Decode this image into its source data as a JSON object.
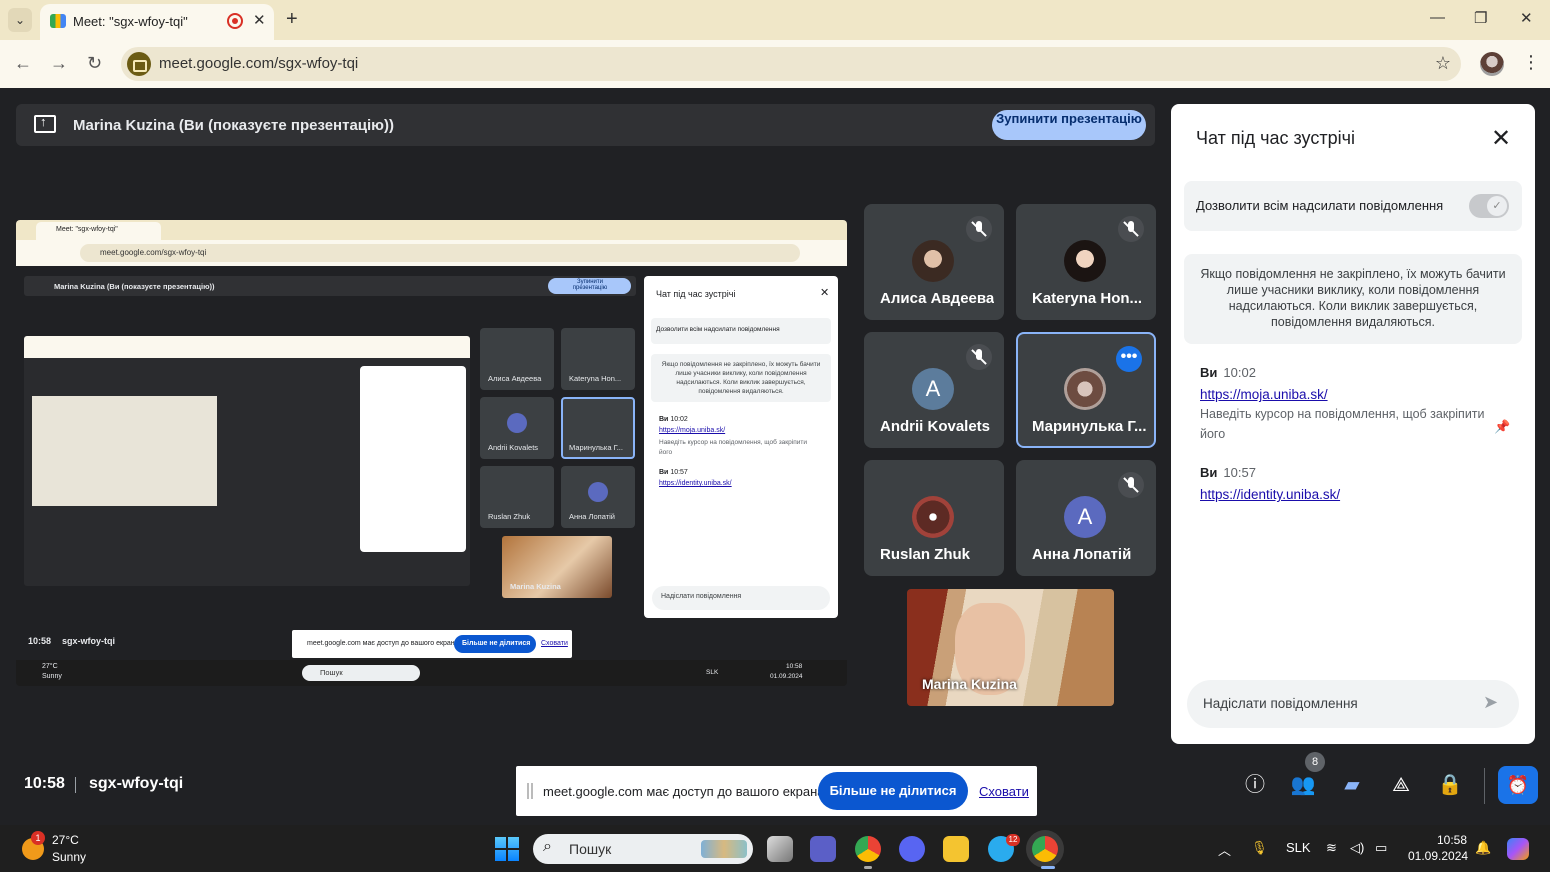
{
  "browser": {
    "tab_title": "Meet: \"sgx-wfoy-tqi\"",
    "url": "meet.google.com/sgx-wfoy-tqi"
  },
  "presentation": {
    "label": "Marina Kuzina (Ви (показуєте презентацію))",
    "stop_button": "Зупинити презентацію"
  },
  "mirror": {
    "tab_title": "Meet: \"sgx-wfoy-tqi\"",
    "url": "meet.google.com/sgx-wfoy-tqi",
    "present_label": "Marina Kuzina (Ви (показуєте презентацію))",
    "stop_button": "Зупинити презентацію",
    "chat_title": "Чат під час зустрічі",
    "allow_label": "Дозволити всім надсилати повідомлення",
    "info": "Якщо повідомлення не закріплено, їх можуть бачити лише учасники виклику, коли повідомлення надсилаються. Коли виклик завершується, повідомлення видаляються.",
    "msg1_time": "10:02",
    "msg1_link": "https://moja.uniba.sk/",
    "msg1_hint": "Наведіть курсор на повідомлення, щоб закріпити його",
    "msg2_time": "10:57",
    "msg2_link": "https://identity.uniba.sk/",
    "input_placeholder": "Надіслати повідомлення",
    "tiles": [
      "Алиса Авдеева",
      "Kateryna Hon...",
      "Andrii Kovalets",
      "Маринулька Г...",
      "Ruslan Zhuk",
      "Анна Лопатій"
    ],
    "self_name": "Marina Kuzina",
    "clock": "10:58",
    "code": "sgx-wfoy-tqi",
    "notice_text": "meet.google.com має доступ до вашого екрана.",
    "notice_button": "Більше не ділитися",
    "notice_hide": "Сховати",
    "temp": "27°C",
    "weather": "Sunny",
    "search": "Пошук",
    "lang": "SLK",
    "time": "10:58",
    "date": "01.09.2024"
  },
  "participants": [
    {
      "name": "Алиса Авдеева",
      "muted": true,
      "avatar": "photo"
    },
    {
      "name": "Kateryna Hon...",
      "muted": true,
      "avatar": "photo"
    },
    {
      "name": "Andrii Kovalets",
      "muted": true,
      "avatar": "A"
    },
    {
      "name": "Маринулька Г...",
      "muted": false,
      "avatar": "photo",
      "active": true
    },
    {
      "name": "Ruslan Zhuk",
      "muted": false,
      "avatar": "photo"
    },
    {
      "name": "Анна Лопатій",
      "muted": true,
      "avatar": "A"
    }
  ],
  "self_tile": {
    "name": "Marina Kuzina"
  },
  "chat": {
    "title": "Чат під час зустрічі",
    "allow_label": "Дозволити всім надсилати повідомлення",
    "info": "Якщо повідомлення не закріплено, їх можуть бачити лише учасники виклику, коли повідомлення надсилаються. Коли виклик завершується, повідомлення видаляються.",
    "messages": [
      {
        "sender": "Ви",
        "time": "10:02",
        "link": "https://moja.uniba.sk/",
        "hint": "Наведіть курсор на повідомлення, щоб закріпити його"
      },
      {
        "sender": "Ви",
        "time": "10:57",
        "link": "https://identity.uniba.sk/"
      }
    ],
    "input_placeholder": "Надіслати повідомлення"
  },
  "meeting_bar": {
    "clock": "10:58",
    "code": "sgx-wfoy-tqi",
    "participant_count": "8",
    "share_notice": "meet.google.com має доступ до вашого екрана.",
    "stop_sharing_button": "Більше не ділитися",
    "hide_link": "Сховати"
  },
  "taskbar": {
    "weather_badge": "1",
    "temp": "27°C",
    "weather": "Sunny",
    "search_placeholder": "Пошук",
    "telegram_badge": "12",
    "lang": "SLK",
    "time": "10:58",
    "date": "01.09.2024"
  }
}
